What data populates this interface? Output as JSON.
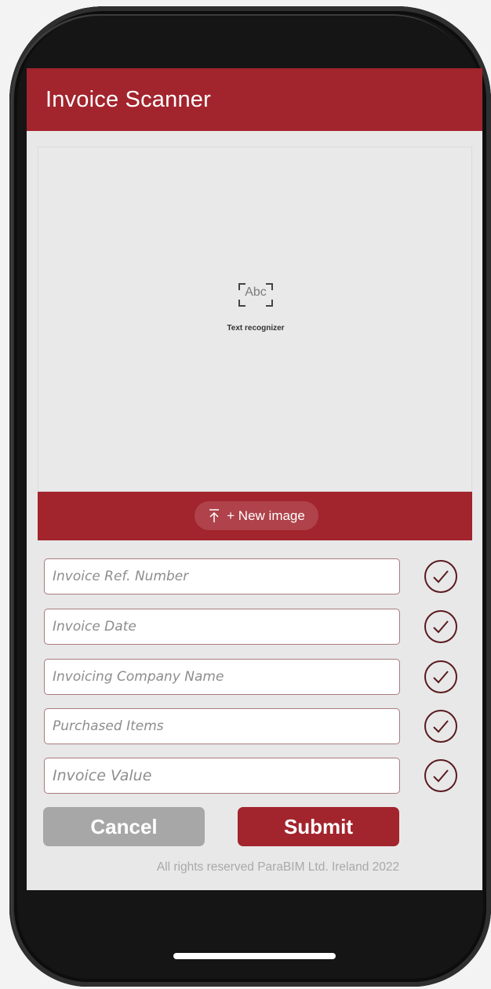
{
  "app": {
    "title": "Invoice Scanner"
  },
  "image_panel": {
    "icon_text": "Abc",
    "label": "Text recognizer",
    "new_image_label": "+ New image"
  },
  "fields": {
    "ref_number": {
      "placeholder": "Invoice Ref. Number",
      "value": ""
    },
    "date": {
      "placeholder": "Invoice Date",
      "value": ""
    },
    "company": {
      "placeholder": "Invoicing Company Name",
      "value": ""
    },
    "items": {
      "placeholder": "Purchased Items",
      "value": ""
    },
    "value": {
      "placeholder": "Invoice Value",
      "value": ""
    }
  },
  "actions": {
    "cancel": "Cancel",
    "submit": "Submit"
  },
  "footer": "All rights reserved ParaBIM Ltd. Ireland 2022",
  "colors": {
    "brand": "#a2242d",
    "check": "#5a1a1e",
    "cancel": "#a7a7a7"
  }
}
